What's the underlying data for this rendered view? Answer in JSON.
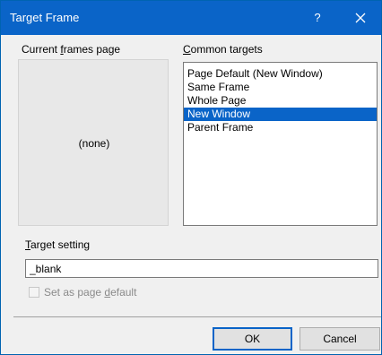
{
  "window": {
    "title": "Target Frame",
    "help_label": "?",
    "close_icon": "close-icon"
  },
  "frames": {
    "label_before": "Current ",
    "label_mnemonic": "f",
    "label_after": "rames page",
    "none_text": "(none)"
  },
  "targets": {
    "label_before": "",
    "label_mnemonic": "C",
    "label_after": "ommon targets",
    "items": [
      "Page Default (New Window)",
      "Same Frame",
      "Whole Page",
      "New Window",
      "Parent Frame"
    ],
    "selected": "New Window"
  },
  "target_setting": {
    "label_before": "",
    "label_mnemonic": "T",
    "label_after": "arget setting",
    "value": "_blank"
  },
  "set_default": {
    "label_before": "Set as page ",
    "label_mnemonic": "d",
    "label_after": "efault",
    "checked": false
  },
  "buttons": {
    "ok": "OK",
    "cancel": "Cancel"
  }
}
